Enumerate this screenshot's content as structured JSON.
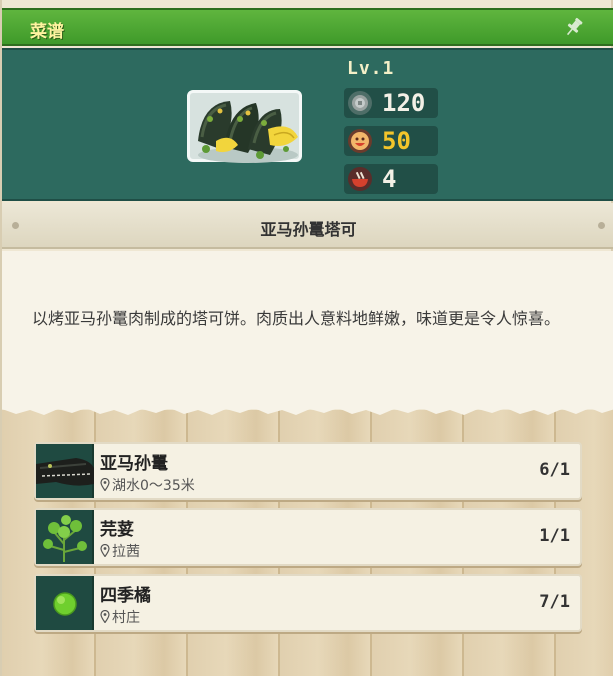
{
  "window": {
    "title": "菜谱"
  },
  "dish": {
    "level": "Lv.1",
    "stats": [
      {
        "icon": "coin-icon",
        "value": "120",
        "color": "#f3f0e6"
      },
      {
        "icon": "taste-icon",
        "value": "50",
        "color": "#f3c52b"
      },
      {
        "icon": "bowl-icon",
        "value": "4",
        "color": "#f3f0e6"
      }
    ],
    "name": "亚马孙鼍塔可",
    "description": "以烤亚马孙鼍肉制成的塔可饼。肉质出人意料地鲜嫩，味道更是令人惊喜。"
  },
  "ingredients": [
    {
      "name": "亚马孙鼍",
      "location": "湖水0～35米",
      "count": "6/1",
      "icon": "caiman-icon"
    },
    {
      "name": "芫荽",
      "location": "拉茜",
      "count": "1/1",
      "icon": "cilantro-icon"
    },
    {
      "name": "四季橘",
      "location": "村庄",
      "count": "7/1",
      "icon": "calamansi-icon"
    }
  ],
  "colors": {
    "title_green": "#4aa632",
    "panel_teal": "#2d6a5f",
    "accent_yellow": "#f3c52b"
  }
}
